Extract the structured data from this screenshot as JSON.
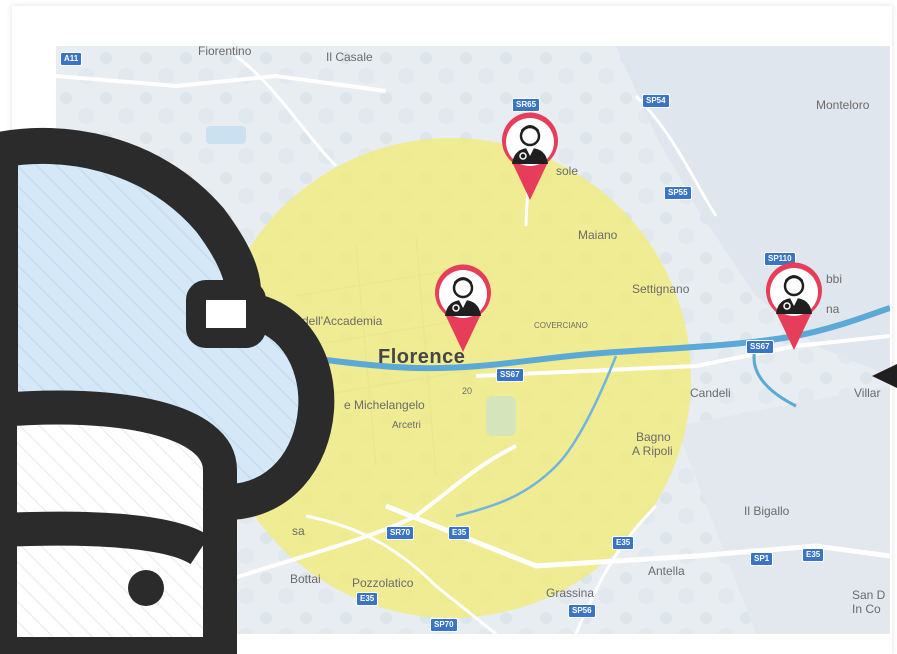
{
  "labels": {
    "fiorentino": "Fiorentino",
    "il_casale": "Il Casale",
    "monteloro": "Monteloro",
    "fiesole": "sole",
    "maiano": "Maiano",
    "settignano": "Settignano",
    "accademia": "a dell'Accademia",
    "florence": "Florence",
    "coverciano": "COVERCIANO",
    "michelangelo": "e Michelangelo",
    "arcetri": "Arcetri",
    "candeli": "Candeli",
    "villa": "Villar",
    "bagno": "Bagno",
    "a_ripoli": "A Ripoli",
    "il_bigallo": "Il Bigallo",
    "antella": "Antella",
    "bottai": "Bottai",
    "pozzolatico": "Pozzolatico",
    "grassina": "Grassina",
    "sa": "sa",
    "san_d": "San D",
    "in_co": "In Co",
    "pont": "bbi",
    "rina": "na"
  },
  "roads": {
    "a11": "A11",
    "sr65": "SR65",
    "sp54": "SP54",
    "sp55": "SP55",
    "sp110": "SP110",
    "ss67a": "SS67",
    "ss67b": "SS67",
    "sr70": "SR70",
    "e35a": "E35",
    "e35b": "E35",
    "e35c": "E35",
    "sp1": "SP1",
    "e35d": "E35",
    "sp56": "SP56",
    "sp70": "SP70",
    "s20": "20"
  },
  "colors": {
    "water": "#5aa9d6",
    "land": "#e6ecf1",
    "radius": "#f3ec6e",
    "pin": "#e63e5a",
    "overlay_dark": "#2b2b2b",
    "overlay_fill": "#d4e8f8"
  },
  "icons": {
    "marker": "doctor-marker-icon",
    "overlay": "database-cloud-icon",
    "arrow": "arrow-left-icon"
  }
}
